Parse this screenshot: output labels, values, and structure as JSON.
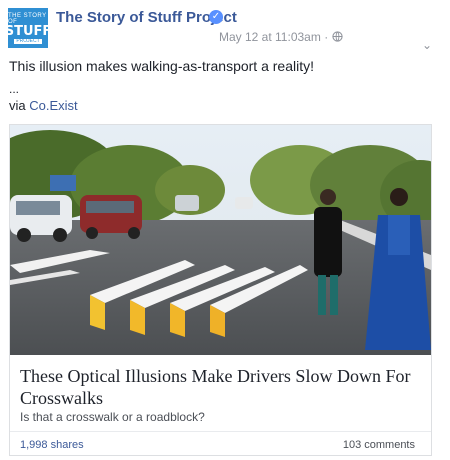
{
  "header": {
    "avatar": {
      "line1": "THE STORY OF",
      "line2": "STUFF",
      "line3": "PROJECT"
    },
    "page_name": "The Story of Stuff Project",
    "timestamp": "May 12 at 11:03am",
    "dot": "·",
    "verified_glyph": "✓",
    "globe_glyph": "🌐",
    "options_glyph": "⌄"
  },
  "post": {
    "text": "This illusion makes walking-as-transport a reality!",
    "ellipsis": "...",
    "via_prefix": "via",
    "via_link": "Co.Exist"
  },
  "card": {
    "title": "These Optical Illusions Make Drivers Slow Down For Crosswalks",
    "subtitle": "Is that a crosswalk or a roadblock?",
    "shares": "1,998 shares",
    "comments": "103 comments"
  },
  "colors": {
    "link": "#3b5998",
    "verified": "#5890ff",
    "avatar_bg": "#2f8fd3"
  }
}
